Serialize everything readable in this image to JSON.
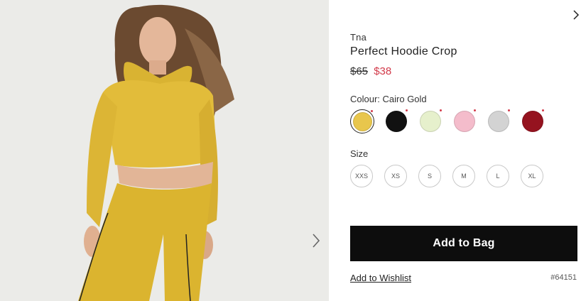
{
  "product": {
    "brand": "Tna",
    "title": "Perfect Hoodie Crop",
    "price_original": "$65",
    "price_sale": "$38",
    "colour_label": "Colour: Cairo Gold",
    "size_label": "Size",
    "sku": "#64151"
  },
  "colours": [
    {
      "name": "Cairo Gold",
      "hex": "#e8c64c",
      "selected": true
    },
    {
      "name": "Black",
      "hex": "#111111",
      "selected": false
    },
    {
      "name": "Pale Green",
      "hex": "#e6f0cc",
      "selected": false
    },
    {
      "name": "Pink",
      "hex": "#f4bccb",
      "selected": false
    },
    {
      "name": "Heather Grey",
      "hex": "#d3d3d3",
      "selected": false
    },
    {
      "name": "Red",
      "hex": "#95131f",
      "selected": false
    }
  ],
  "sizes": [
    "XXS",
    "XS",
    "S",
    "M",
    "L",
    "XL"
  ],
  "actions": {
    "add_to_bag": "Add to Bag",
    "wishlist": "Add to Wishlist"
  },
  "icons": {
    "close": "close-icon",
    "next": "chevron-right-icon"
  },
  "colors": {
    "sale": "#d23a4a",
    "button": "#0d0d0d"
  }
}
